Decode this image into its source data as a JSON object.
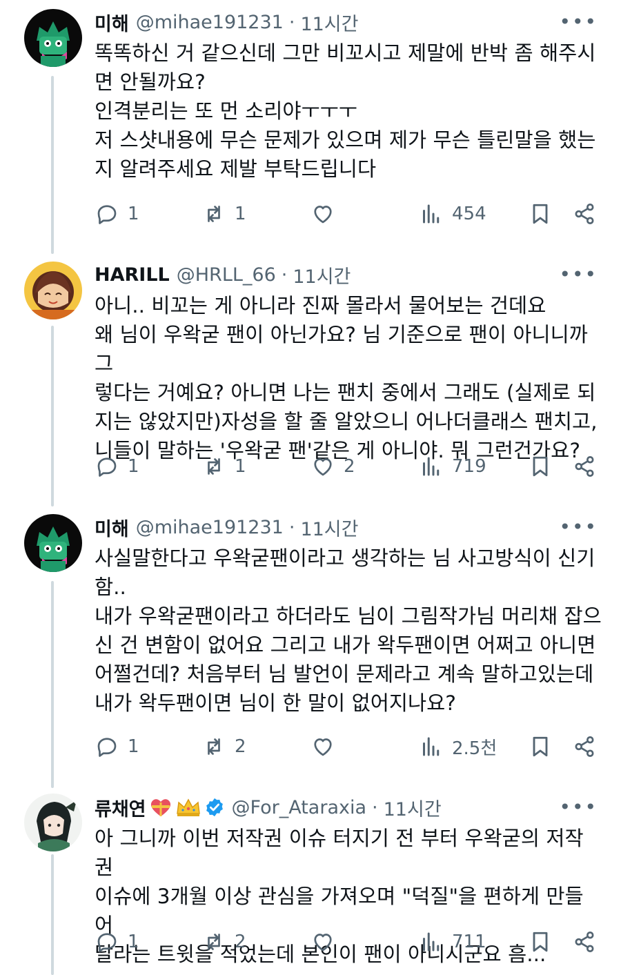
{
  "tweets": [
    {
      "name": "미해",
      "handle": "@mihae191231",
      "separator": "·",
      "time": "11시간",
      "avatar": "green-character-avatar",
      "lines": [
        "똑똑하신 거 같으신데 그만 비꼬시고 제말에 반박 좀 해주시",
        "면 안될까요?",
        "인격분리는 또 먼 소리야ㅜㅜㅜ",
        "저 스샷내용에 무슨 문제가 있으며 제가 무슨 틀린말을 했는",
        "지 알려주세요 제발 부탁드립니다"
      ],
      "replies": "1",
      "reposts": "1",
      "likes": "",
      "views": "454"
    },
    {
      "name": "HARILL",
      "handle": "@HRLL_66",
      "separator": "·",
      "time": "11시간",
      "avatar": "brown-hair-character-avatar",
      "lines": [
        "아니.. 비꼬는 게 아니라 진짜 몰라서 물어보는 건데요",
        "왜 님이 우왁굳 팬이 아닌가요? 님 기준으로 팬이 아니니까 그",
        "렇다는 거예요? 아니면 나는 팬치 중에서 그래도 (실제로 되",
        "지는 않았지만)자성을 할 줄 알았으니 어나더클래스 팬치고,",
        "니들이 말하는 '우왁굳 팬'같은 게 아니야. 뭐 그런건가요?"
      ],
      "replies": "1",
      "reposts": "1",
      "likes": "2",
      "views": "719"
    },
    {
      "name": "미해",
      "handle": "@mihae191231",
      "separator": "·",
      "time": "11시간",
      "avatar": "green-character-avatar",
      "lines": [
        "사실말한다고 우왁굳팬이라고 생각하는 님 사고방식이 신기",
        "함..",
        "내가 우왁굳팬이라고 하더라도 님이 그림작가님 머리채 잡으",
        "신 건 변함이 없어요 그리고 내가 왁두팬이면 어쩌고 아니면",
        "어쩔건데? 처음부터 님 발언이 문제라고 계속 말하고있는데",
        "내가 왁두팬이면 님이 한 말이 없어지나요?"
      ],
      "replies": "1",
      "reposts": "2",
      "likes": "",
      "views": "2.5천"
    },
    {
      "name": "류채연",
      "handle": "@For_Ataraxia",
      "separator": "·",
      "time": "11시간",
      "avatar": "anime-girl-avatar",
      "badges": [
        "heart-emoji-icon",
        "crown-emoji-icon",
        "verified-badge-icon"
      ],
      "lines": [
        "아 그니까 이번 저작권 이슈 터지기 전 부터 우왁굳의 저작권",
        "이슈에 3개월 이상 관심을 가져오며 \"덕질\"을 편하게 만들어",
        "달라는 트윗을 적었는데 본인이 팬이 아니시군요 흠..."
      ],
      "replies": "1",
      "reposts": "2",
      "likes": "",
      "views": "711"
    }
  ],
  "icons": {
    "reply": "reply-bubble-icon",
    "repost": "repost-arrows-icon",
    "like": "heart-outline-icon",
    "views": "views-bar-chart-icon",
    "bookmark": "bookmark-icon",
    "share": "share-icon",
    "more": "more-dots-icon"
  },
  "more_label": "•••",
  "colors": {
    "text": "#0f1419",
    "secondary": "#536471",
    "thread_line": "#cfd9de",
    "verified": "#1d9bf0"
  }
}
